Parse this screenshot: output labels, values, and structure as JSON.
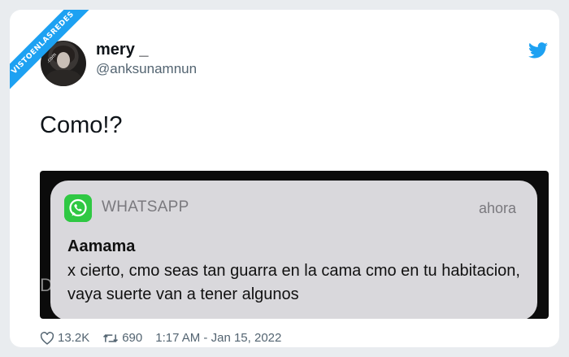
{
  "watermark": {
    "text": "VISTOENLASREDES",
    "sub": ".com"
  },
  "user": {
    "name": "mery _",
    "handle": "@anksunamnun"
  },
  "tweet": {
    "text": "Como!?"
  },
  "notification": {
    "app": "WHATSAPP",
    "time": "ahora",
    "sender": "Aamama",
    "message": "x cierto, cmo seas tan guarra en la cama cmo en tu habitacion, vaya suerte van a tener algunos",
    "background_fragment": "D"
  },
  "stats": {
    "likes": "13.2K",
    "retweets": "690",
    "timestamp": "1:17 AM - Jan 15, 2022"
  },
  "icons": {
    "brand": "twitter-bird-icon",
    "like": "heart-icon",
    "retweet": "retweet-icon",
    "app": "whatsapp-icon"
  },
  "colors": {
    "twitter_blue": "#1da1f2",
    "whatsapp_green": "#25c23c"
  }
}
